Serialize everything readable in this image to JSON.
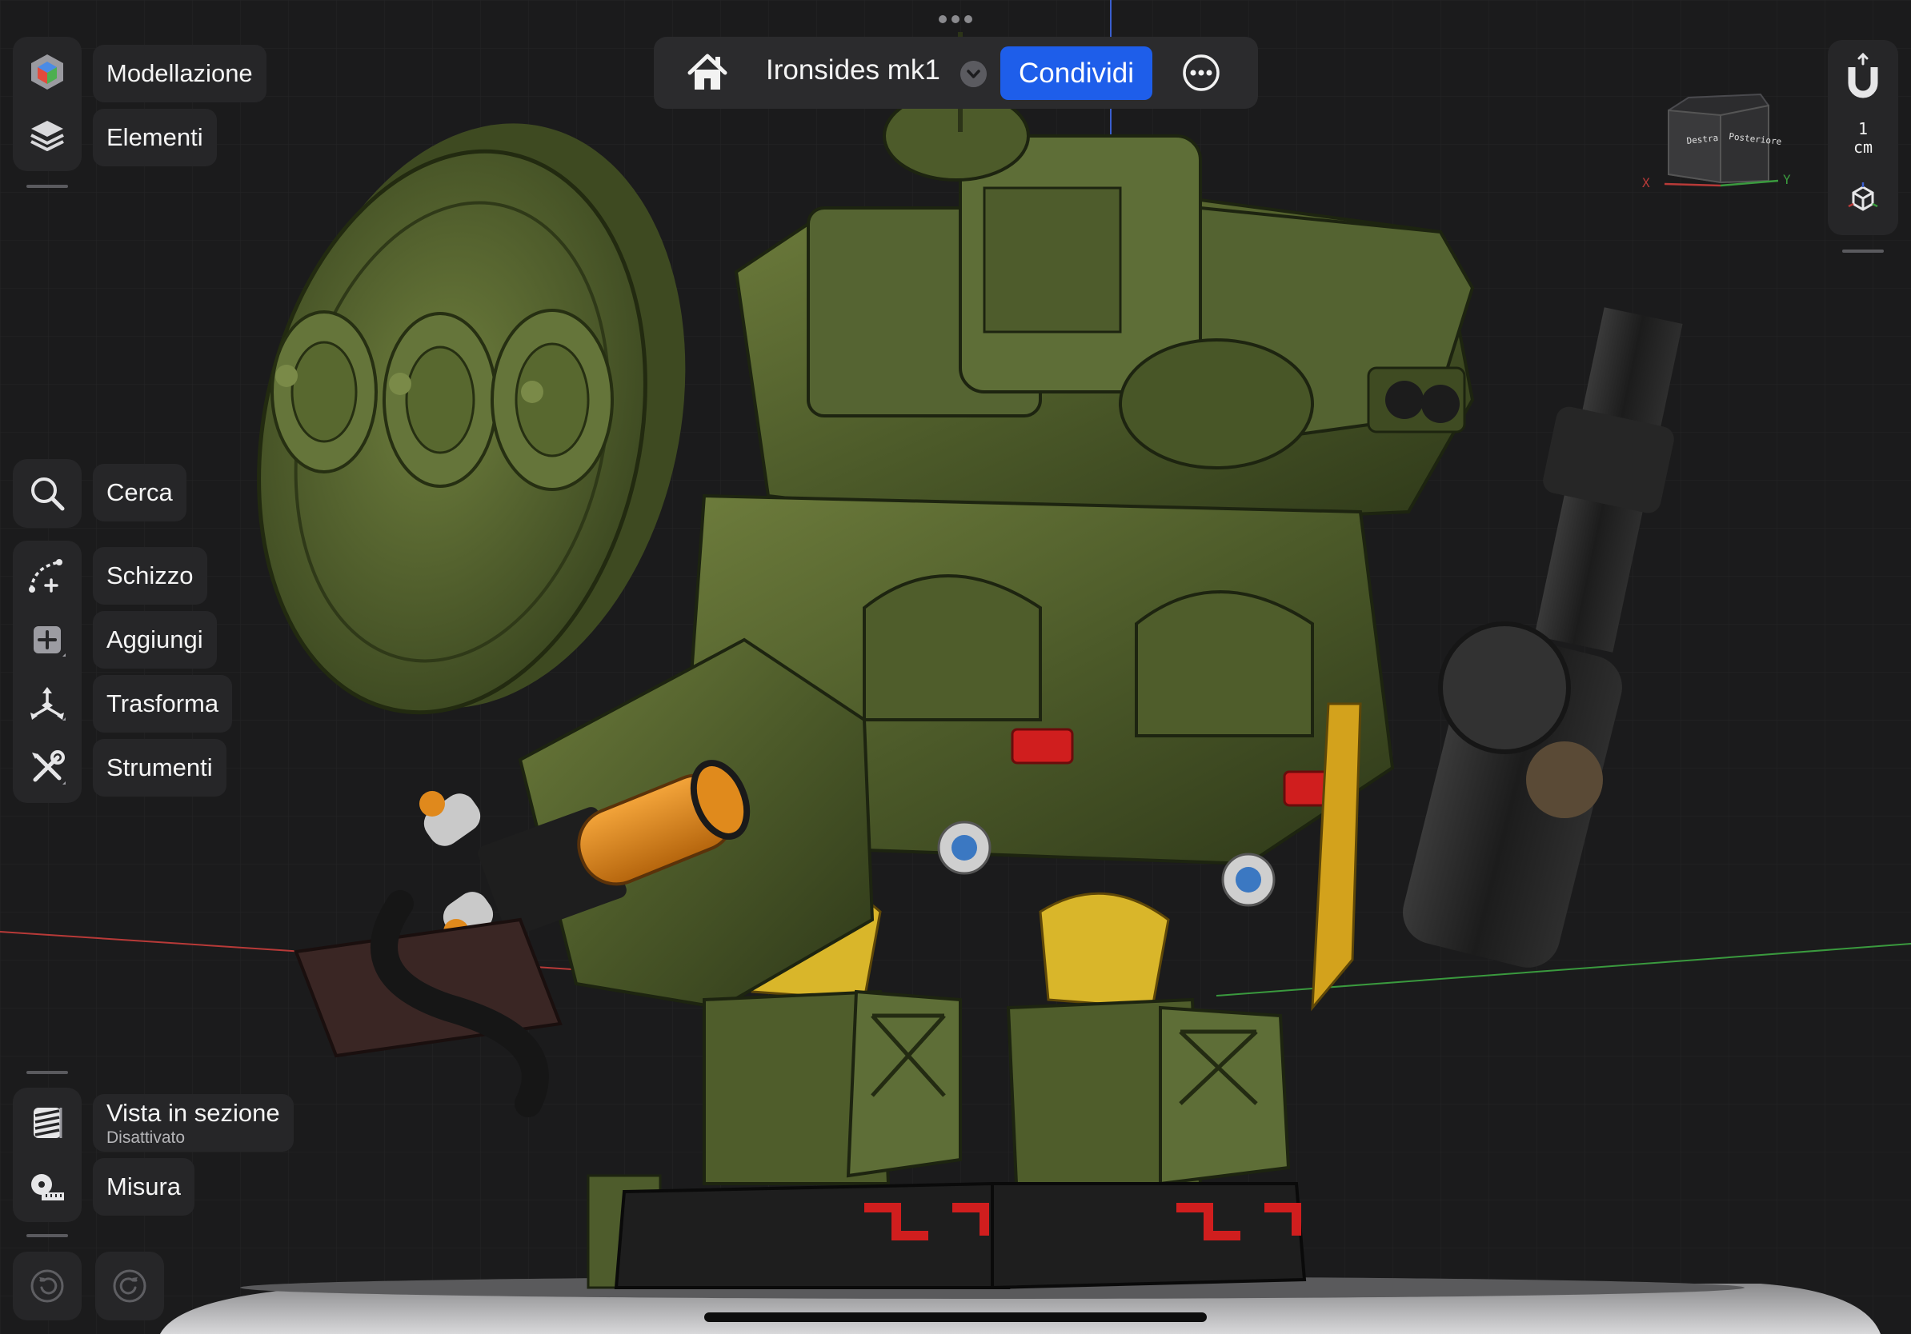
{
  "document": {
    "title": "Ironsides mk1",
    "share_label": "Condividi"
  },
  "left_menu": {
    "top": [
      {
        "label": "Modellazione",
        "icon": "modeling-cube-icon"
      },
      {
        "label": "Elementi",
        "icon": "layers-icon"
      }
    ],
    "tools": [
      {
        "label": "Cerca",
        "icon": "search-icon"
      },
      {
        "label": "Schizzo",
        "icon": "sketch-icon"
      },
      {
        "label": "Aggiungi",
        "icon": "add-icon"
      },
      {
        "label": "Trasforma",
        "icon": "transform-icon"
      },
      {
        "label": "Strumenti",
        "icon": "tools-icon"
      }
    ],
    "bottom": [
      {
        "label": "Vista in sezione",
        "sublabel": "Disattivato",
        "icon": "section-view-icon"
      },
      {
        "label": "Misura",
        "icon": "tape-measure-icon"
      }
    ],
    "history": [
      {
        "icon": "undo-icon"
      },
      {
        "icon": "redo-icon"
      }
    ]
  },
  "right_menu": {
    "snap_icon": "magnet-icon",
    "unit": {
      "value": "1",
      "unit": "cm"
    },
    "view_icon": "projection-cube-icon"
  },
  "viewcube": {
    "faces": [
      "Destra",
      "Posteriore"
    ],
    "axes": [
      "X",
      "Y"
    ]
  },
  "colors": {
    "accent": "#1e5eea",
    "background": "#1b1b1c",
    "model_green": "#4e5d2c",
    "axis_x": "#b83a38",
    "axis_y": "#3a9a3e",
    "axis_z": "#3a5fcf"
  }
}
